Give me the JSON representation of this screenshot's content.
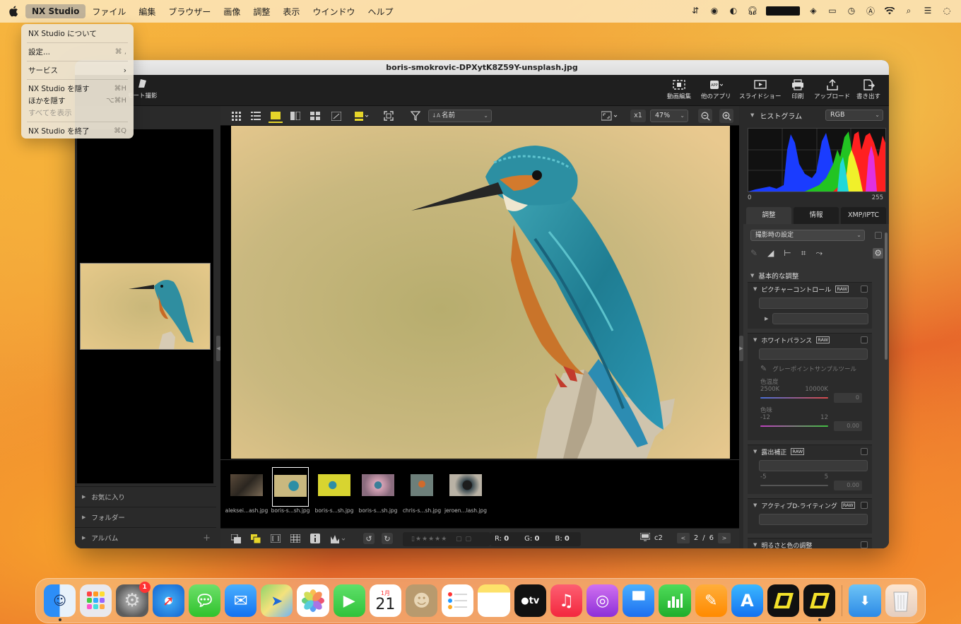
{
  "menubar": {
    "app_name": "NX Studio",
    "items": [
      "ファイル",
      "編集",
      "ブラウザー",
      "画像",
      "調整",
      "表示",
      "ウインドウ",
      "ヘルプ"
    ]
  },
  "app_menu": {
    "about": "NX Studio について",
    "settings": "設定...",
    "settings_shortcut": "⌘ ,",
    "services": "サービス",
    "hide": "NX Studio を隠す",
    "hide_shortcut": "⌘H",
    "hide_others": "ほかを隠す",
    "hide_others_shortcut": "⌥⌘H",
    "show_all": "すべてを表示",
    "quit": "NX Studio を終了",
    "quit_shortcut": "⌘Q"
  },
  "window": {
    "title": "boris-smokrovic-DPXytK8Z59Y-unsplash.jpg"
  },
  "toolbar": {
    "remote": "モート撮影",
    "video_edit": "動画編集",
    "other_apps": "他のアプリ",
    "slideshow": "スライドショー",
    "print": "印刷",
    "upload": "アップロード",
    "export": "書き出す"
  },
  "left_panel": {
    "favorites": "お気に入り",
    "folders": "フォルダー",
    "albums": "アルバム"
  },
  "view_toolbar": {
    "sort_label": "名前",
    "x1": "x1",
    "zoom": "47%"
  },
  "filmstrip": [
    {
      "label": "aleksei...ash.jpg"
    },
    {
      "label": "boris-s...sh.jpg"
    },
    {
      "label": "boris-s...sh.jpg"
    },
    {
      "label": "boris-s...sh.jpg"
    },
    {
      "label": "chris-s...sh.jpg"
    },
    {
      "label": "jeroen...lash.jpg"
    }
  ],
  "bottom_bar": {
    "r_label": "R:",
    "r_value": "0",
    "g_label": "G:",
    "g_value": "0",
    "b_label": "B:",
    "b_value": "0",
    "monitor": "c2",
    "page_current": "2",
    "page_sep": "/",
    "page_total": "6"
  },
  "right_panel": {
    "histogram_title": "ヒストグラム",
    "channel": "RGB",
    "scale_min": "0",
    "scale_max": "255",
    "tabs": [
      "調整",
      "情報",
      "XMP/IPTC"
    ],
    "preset": "撮影時の設定",
    "basic_section": "基本的な調整",
    "picture_control": "ピクチャーコントロール",
    "white_balance": "ホワイトバランス",
    "gray_point_tool": "グレーポイントサンプルツール",
    "color_temp": "色温度",
    "temp_min": "2500K",
    "temp_max": "10000K",
    "temp_value": "0",
    "tint": "色味",
    "tint_min": "-12",
    "tint_max": "12",
    "tint_value": "0.00",
    "exposure": "露出補正",
    "exp_min": "-5",
    "exp_max": "5",
    "exp_value": "0.00",
    "active_d": "アクティブD-ライティング",
    "brightness": "明るさと色の調整",
    "raw": "RAW"
  },
  "dock": {
    "calendar_month": "1月",
    "calendar_day": "21",
    "settings_badge": "1",
    "tv": "tv"
  },
  "colors": {
    "accent_yellow": "#e6d52a",
    "window_bg": "#2b2b2b"
  }
}
